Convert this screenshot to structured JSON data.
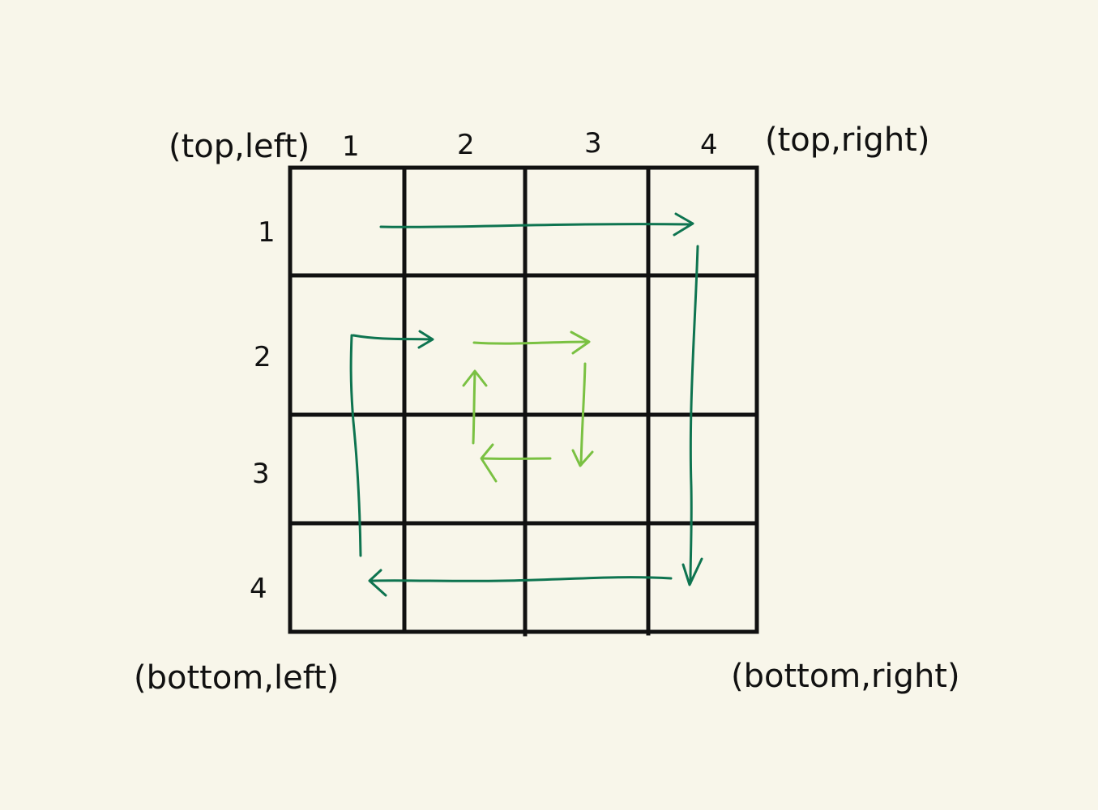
{
  "corners": {
    "top_left": "(top,left)",
    "top_right": "(top,right)",
    "bottom_left": "(bottom,left)",
    "bottom_right": "(bottom,right)"
  },
  "column_labels": [
    "1",
    "2",
    "3",
    "4"
  ],
  "row_labels": [
    "1",
    "2",
    "3",
    "4"
  ],
  "colors": {
    "grid": "#111111",
    "outer_spiral": "#0e7450",
    "inner_spiral": "#7ac142",
    "background": "#f8f6ea"
  }
}
